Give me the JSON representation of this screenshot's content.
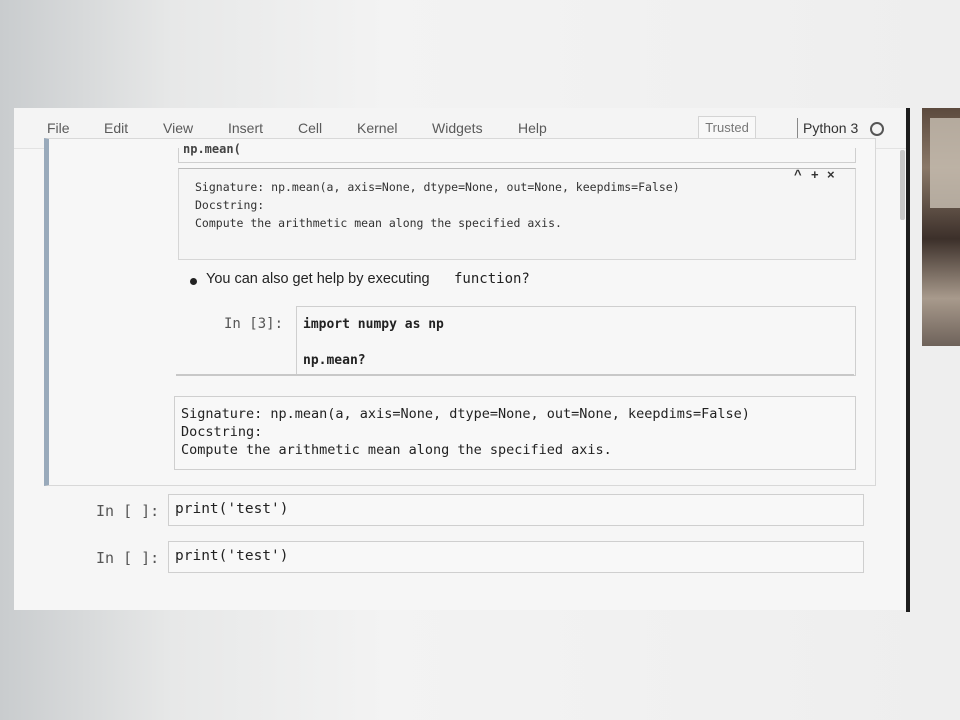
{
  "menubar": {
    "items": [
      "File",
      "Edit",
      "View",
      "Insert",
      "Cell",
      "Kernel",
      "Widgets",
      "Help"
    ],
    "trusted_label": "Trusted",
    "kernel_name": "Python 3"
  },
  "top_cell": {
    "partial_code": "np.mean("
  },
  "pager": {
    "controls": [
      "^",
      "+",
      "×"
    ],
    "signature": "Signature: np.mean(a, axis=None, dtype=None, out=None, keepdims=False)",
    "docstring_label": "Docstring:",
    "docstring": "Compute the arithmetic mean along the specified axis."
  },
  "markdown": {
    "bullet_text": "You can also get help by executing ",
    "bullet_code": "function?"
  },
  "cell3": {
    "prompt": "In [3]:",
    "line1": "import numpy as np",
    "line2": "np.mean?"
  },
  "output": {
    "signature": "Signature: np.mean(a, axis=None, dtype=None, out=None, keepdims=False)",
    "docstring_label": "Docstring:",
    "docstring": "Compute the arithmetic mean along the specified axis."
  },
  "cells": [
    {
      "prompt": "In [ ]:",
      "code": "print('test')"
    },
    {
      "prompt": "In [ ]:",
      "code": "print('test')"
    }
  ]
}
